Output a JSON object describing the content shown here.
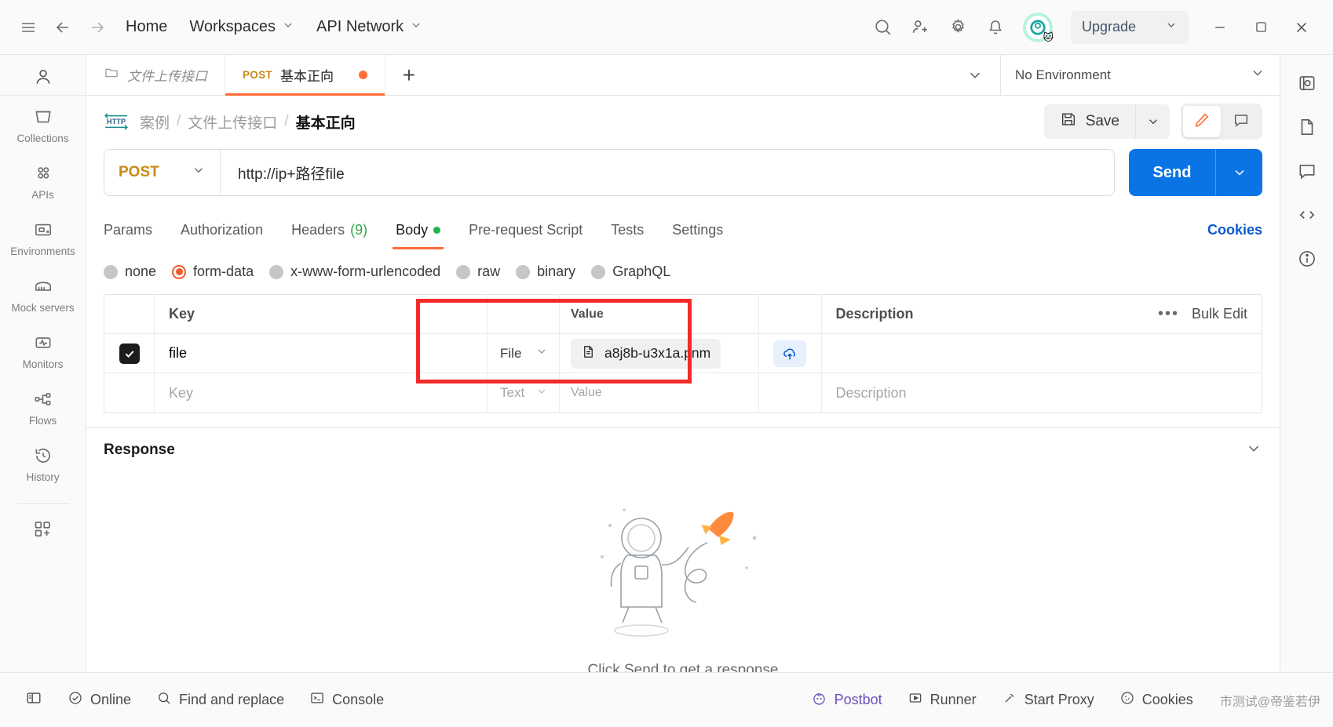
{
  "topbar": {
    "menu_icon": "hamburger-icon",
    "back_icon": "arrow-left-icon",
    "forward_icon": "arrow-right-icon",
    "home_label": "Home",
    "workspaces_label": "Workspaces",
    "api_network_label": "API Network",
    "search_icon": "search-icon",
    "invite_icon": "person-add-icon",
    "settings_icon": "gear-icon",
    "notifications_icon": "bell-icon",
    "avatar_icon": "avatar",
    "upgrade_label": "Upgrade",
    "minimize_label": "—",
    "maximize_label": "□",
    "close_label": "✕"
  },
  "sidebar": {
    "user_icon": "person-icon",
    "items": [
      {
        "label": "Collections",
        "icon": "collections-icon"
      },
      {
        "label": "APIs",
        "icon": "apis-icon"
      },
      {
        "label": "Environments",
        "icon": "environments-icon"
      },
      {
        "label": "Mock servers",
        "icon": "mock-servers-icon"
      },
      {
        "label": "Monitors",
        "icon": "monitors-icon"
      },
      {
        "label": "Flows",
        "icon": "flows-icon"
      },
      {
        "label": "History",
        "icon": "history-icon"
      }
    ],
    "add_label": "new-element-icon"
  },
  "rightrail": {
    "items": [
      {
        "icon": "vault-icon"
      },
      {
        "icon": "documentation-icon"
      },
      {
        "icon": "comments-icon"
      },
      {
        "icon": "code-snippet-icon"
      },
      {
        "icon": "info-icon"
      }
    ]
  },
  "tabstrip": {
    "tabs": [
      {
        "label": "文件上传接口",
        "method": "",
        "active": false,
        "dirty": false
      },
      {
        "label": "基本正向",
        "method": "POST",
        "active": true,
        "dirty": true
      }
    ],
    "new_tab_label": "+",
    "overflow_icon": "chevron-down-icon",
    "environment_label": "No Environment",
    "environment_caret": "chevron-down-icon"
  },
  "request": {
    "protocol_badge": "HTTP",
    "breadcrumb": [
      "案例",
      "文件上传接口",
      "基本正向"
    ],
    "breadcrumb_sep": "/",
    "save_label": "Save",
    "save_icon": "floppy-disk-icon",
    "save_caret": "chevron-down-icon",
    "edit_icon": "pencil-icon",
    "comment_icon": "comment-icon",
    "method": "POST",
    "method_caret": "chevron-down-icon",
    "url": "http://ip+路径file",
    "send_label": "Send",
    "send_caret": "chevron-down-icon"
  },
  "request_tabs": {
    "items": [
      {
        "label": "Params",
        "badge": "",
        "active": false,
        "dot": false
      },
      {
        "label": "Authorization",
        "badge": "",
        "active": false,
        "dot": false
      },
      {
        "label": "Headers",
        "badge": "(9)",
        "active": false,
        "dot": false
      },
      {
        "label": "Body",
        "badge": "",
        "active": true,
        "dot": true
      },
      {
        "label": "Pre-request Script",
        "badge": "",
        "active": false,
        "dot": false
      },
      {
        "label": "Tests",
        "badge": "",
        "active": false,
        "dot": false
      },
      {
        "label": "Settings",
        "badge": "",
        "active": false,
        "dot": false
      }
    ],
    "cookies_label": "Cookies"
  },
  "body_types": {
    "options": [
      {
        "label": "none",
        "selected": false
      },
      {
        "label": "form-data",
        "selected": true
      },
      {
        "label": "x-www-form-urlencoded",
        "selected": false
      },
      {
        "label": "raw",
        "selected": false
      },
      {
        "label": "binary",
        "selected": false
      },
      {
        "label": "GraphQL",
        "selected": false
      }
    ]
  },
  "form_data": {
    "columns": {
      "key": "Key",
      "value": "Value",
      "description": "Description"
    },
    "more_icon": "ellipsis-icon",
    "bulk_edit_label": "Bulk Edit",
    "rows": [
      {
        "checked": true,
        "key": "file",
        "type": "File",
        "type_caret": "chevron-down-icon",
        "file_name": "a8j8b-u3x1a.pnm",
        "file_icon": "document-icon",
        "upload_icon": "cloud-upload-icon",
        "description": ""
      },
      {
        "checked": false,
        "key": "Key",
        "type": "Text",
        "type_caret": "chevron-down-icon",
        "file_name": "Value",
        "file_icon": "",
        "upload_icon": "",
        "description": "Description"
      }
    ]
  },
  "response": {
    "title": "Response",
    "collapse_icon": "chevron-down-icon",
    "empty_message": "Click Send to get a response",
    "illustration": "astronaut-rocket-illustration"
  },
  "footer": {
    "sidebar_toggle_icon": "panel-toggle-icon",
    "online_label": "Online",
    "online_icon": "check-circle-icon",
    "find_replace_label": "Find and replace",
    "find_icon": "search-icon",
    "console_label": "Console",
    "console_icon": "terminal-icon",
    "postbot_label": "Postbot",
    "postbot_icon": "postbot-icon",
    "runner_label": "Runner",
    "runner_icon": "play-icon",
    "start_proxy_label": "Start Proxy",
    "proxy_icon": "antenna-icon",
    "cookies_label": "Cookies",
    "cookies_icon": "cookie-icon",
    "watermark": "市测试@帝鉴若伊"
  },
  "colors": {
    "accent_orange": "#ff6c37",
    "send_blue": "#0b74e5",
    "method_yellow": "#c98a16",
    "highlight_red": "#f42a2a",
    "dot_green": "#22b14c"
  }
}
